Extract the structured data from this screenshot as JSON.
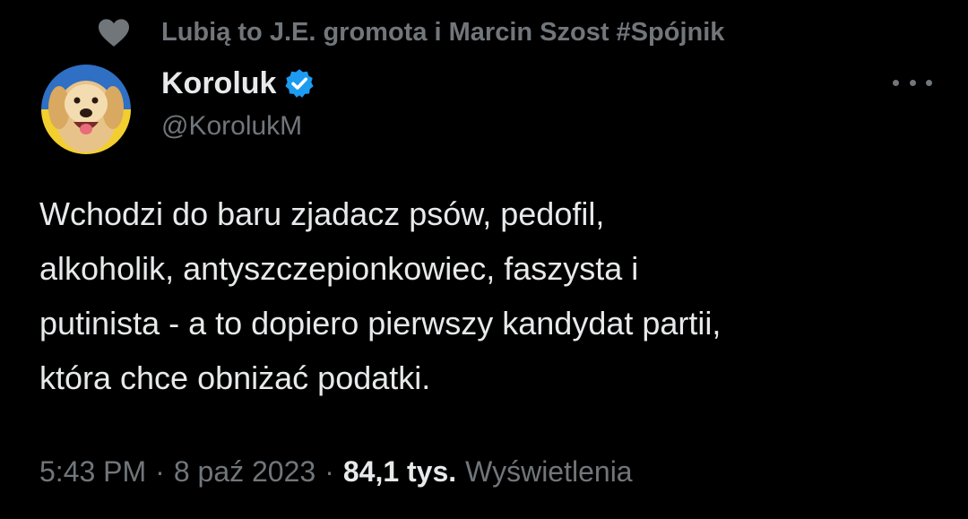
{
  "social_context": {
    "icon": "heart-icon",
    "text": "Lubią to J.E. gromota i Marcin Szost #Spójnik"
  },
  "author": {
    "display_name": "Koroluk",
    "handle": "@KorolukM",
    "verified_icon": "verified-badge-icon",
    "avatar": "dog-with-ukraine-flag-avatar"
  },
  "more_menu_icon": "more-options-icon",
  "tweet": {
    "lines": [
      "Wchodzi do baru zjadacz psów, pedofil,",
      "alkoholik, antyszczepionkowiec, faszysta i",
      "putinista - a to dopiero pierwszy kandydat partii,",
      "która chce obniżać podatki."
    ]
  },
  "meta": {
    "time": "5:43 PM",
    "separator": "·",
    "date": "8 paź 2023",
    "views_count": "84,1 tys.",
    "views_label": "Wyświetlenia"
  },
  "colors": {
    "background": "#000000",
    "primary_text": "#e7e9ea",
    "secondary_text": "#71767b",
    "verified_blue": "#1d9bf0"
  }
}
